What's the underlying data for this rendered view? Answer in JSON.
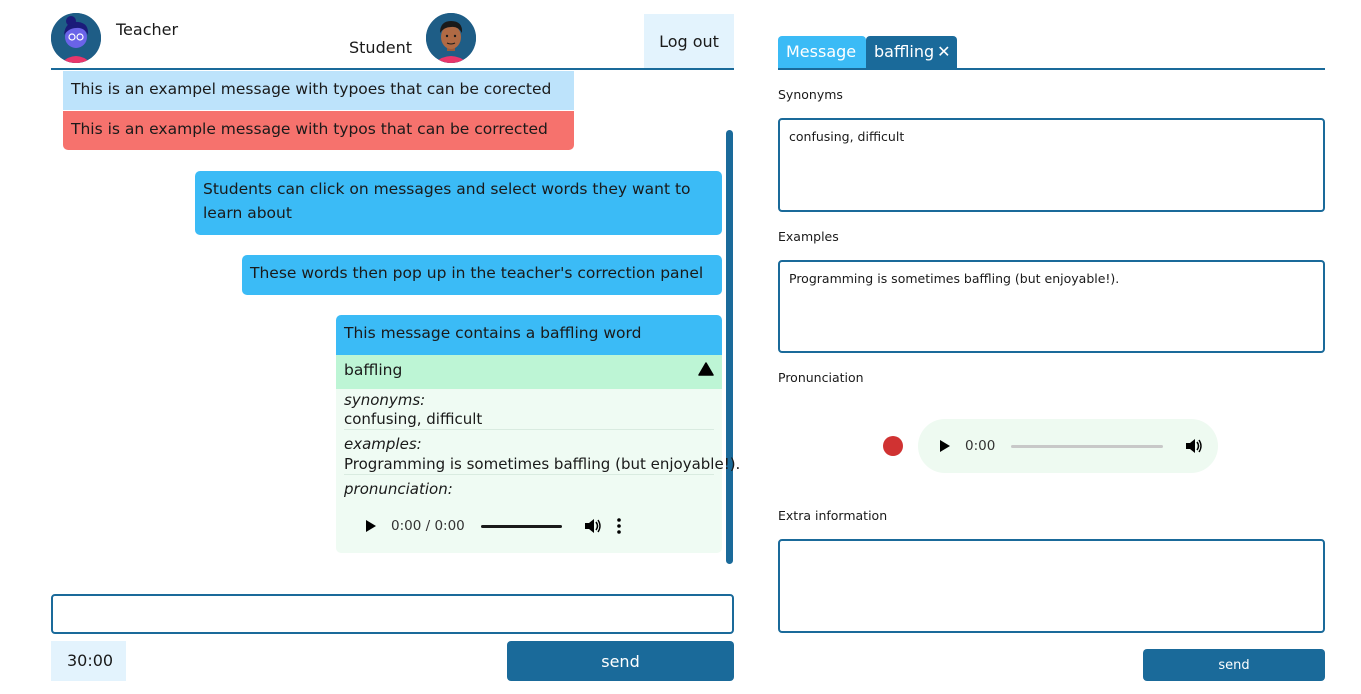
{
  "chat": {
    "teacher_label": "Teacher",
    "student_label": "Student",
    "logout_label": "Log out",
    "correction": {
      "original": "This is an exampel message with typoes that can be corected",
      "corrected": "This is an example message with typos that can be corrected"
    },
    "messages": [
      "Students can click on messages and select words they want to learn about",
      "These words then pop up in the teacher's correction panel",
      "This message contains a baffling word"
    ],
    "word_card": {
      "word": "baffling",
      "synonyms_label": "synonyms:",
      "synonyms": "confusing, difficult",
      "examples_label": "examples:",
      "examples": "Programming is sometimes baffling (but enjoyable!).",
      "pronunciation_label": "pronunciation:",
      "player_time": "0:00 / 0:00"
    },
    "input_value": "",
    "timer": "30:00",
    "send_label": "send"
  },
  "panel": {
    "tabs": [
      {
        "label": "Message"
      },
      {
        "label": "baffling",
        "close_glyph": "✕"
      }
    ],
    "synonyms_label": "Synonyms",
    "synonyms_value": "confusing, difficult",
    "examples_label": "Examples",
    "examples_value": "Programming is sometimes baffling (but enjoyable!).",
    "pronunciation_label": "Pronunciation",
    "player_time": "0:00",
    "extra_label": "Extra information",
    "extra_value": "",
    "send_label": "send"
  },
  "colors": {
    "primary": "#1a6a9a",
    "bubble": "#3bbbf6",
    "original_bg": "#bde3fb",
    "corrected_bg": "#f6726d",
    "word_head_bg": "#bdf5d5",
    "word_body_bg": "#effbf3",
    "record": "#d03232"
  },
  "icons": {
    "teacher_avatar": "avatar-teacher",
    "student_avatar": "avatar-student",
    "collapse": "triangle-up-icon",
    "play": "play-icon",
    "volume": "volume-icon",
    "more": "more-vertical-icon",
    "record": "record-icon",
    "close": "close-icon"
  }
}
